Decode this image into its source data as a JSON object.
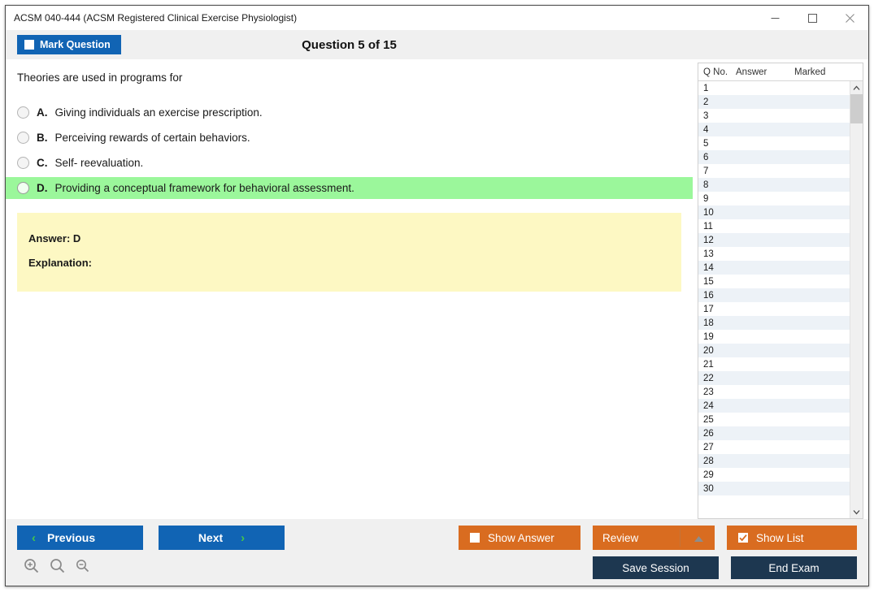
{
  "window": {
    "title": "ACSM 040-444 (ACSM Registered Clinical Exercise Physiologist)",
    "minimize_label": "—",
    "maximize_label": "□",
    "close_label": "✕"
  },
  "header": {
    "mark_question_label": "Mark Question",
    "mark_question_checked": false,
    "question_counter": "Question 5 of 15"
  },
  "question": {
    "stem": "Theories are used in programs for",
    "options": [
      {
        "letter": "A.",
        "text": "Giving individuals an exercise prescription.",
        "correct": false,
        "selected": false
      },
      {
        "letter": "B.",
        "text": "Perceiving rewards of certain behaviors.",
        "correct": false,
        "selected": false
      },
      {
        "letter": "C.",
        "text": "Self- reevaluation.",
        "correct": false,
        "selected": false
      },
      {
        "letter": "D.",
        "text": "Providing a conceptual framework for behavioral assessment.",
        "correct": true,
        "selected": false
      }
    ]
  },
  "answer_panel": {
    "answer_label": "Answer: D",
    "explanation_label": "Explanation:"
  },
  "question_list": {
    "columns": [
      "Q No.",
      "Answer",
      "Marked"
    ],
    "rows": [
      {
        "qno": "1",
        "answer": "",
        "marked": ""
      },
      {
        "qno": "2",
        "answer": "",
        "marked": ""
      },
      {
        "qno": "3",
        "answer": "",
        "marked": ""
      },
      {
        "qno": "4",
        "answer": "",
        "marked": ""
      },
      {
        "qno": "5",
        "answer": "",
        "marked": ""
      },
      {
        "qno": "6",
        "answer": "",
        "marked": ""
      },
      {
        "qno": "7",
        "answer": "",
        "marked": ""
      },
      {
        "qno": "8",
        "answer": "",
        "marked": ""
      },
      {
        "qno": "9",
        "answer": "",
        "marked": ""
      },
      {
        "qno": "10",
        "answer": "",
        "marked": ""
      },
      {
        "qno": "11",
        "answer": "",
        "marked": ""
      },
      {
        "qno": "12",
        "answer": "",
        "marked": ""
      },
      {
        "qno": "13",
        "answer": "",
        "marked": ""
      },
      {
        "qno": "14",
        "answer": "",
        "marked": ""
      },
      {
        "qno": "15",
        "answer": "",
        "marked": ""
      },
      {
        "qno": "16",
        "answer": "",
        "marked": ""
      },
      {
        "qno": "17",
        "answer": "",
        "marked": ""
      },
      {
        "qno": "18",
        "answer": "",
        "marked": ""
      },
      {
        "qno": "19",
        "answer": "",
        "marked": ""
      },
      {
        "qno": "20",
        "answer": "",
        "marked": ""
      },
      {
        "qno": "21",
        "answer": "",
        "marked": ""
      },
      {
        "qno": "22",
        "answer": "",
        "marked": ""
      },
      {
        "qno": "23",
        "answer": "",
        "marked": ""
      },
      {
        "qno": "24",
        "answer": "",
        "marked": ""
      },
      {
        "qno": "25",
        "answer": "",
        "marked": ""
      },
      {
        "qno": "26",
        "answer": "",
        "marked": ""
      },
      {
        "qno": "27",
        "answer": "",
        "marked": ""
      },
      {
        "qno": "28",
        "answer": "",
        "marked": ""
      },
      {
        "qno": "29",
        "answer": "",
        "marked": ""
      },
      {
        "qno": "30",
        "answer": "",
        "marked": ""
      }
    ],
    "scroll_up_label": "ⱏ",
    "scroll_down_label": "ⱟ"
  },
  "footer": {
    "previous_label": "Previous",
    "next_label": "Next",
    "prev_chevron": "‹",
    "next_chevron": "›",
    "show_answer_label": "Show Answer",
    "show_answer_checked": false,
    "review_label": "Review",
    "review_arrow": "▲",
    "show_list_label": "Show List",
    "show_list_checked": true,
    "save_session_label": "Save Session",
    "end_exam_label": "End Exam",
    "zoom_in_icon": "zoom-in-icon",
    "zoom_reset_icon": "zoom-reset-icon",
    "zoom_out_icon": "zoom-out-icon"
  },
  "colors": {
    "primary_blue": "#1164b4",
    "orange": "#d96c20",
    "dark_navy": "#1d3750",
    "correct_green": "#9bf79b",
    "answer_yellow": "#fdf8c3",
    "chevron_green": "#44c64a"
  }
}
